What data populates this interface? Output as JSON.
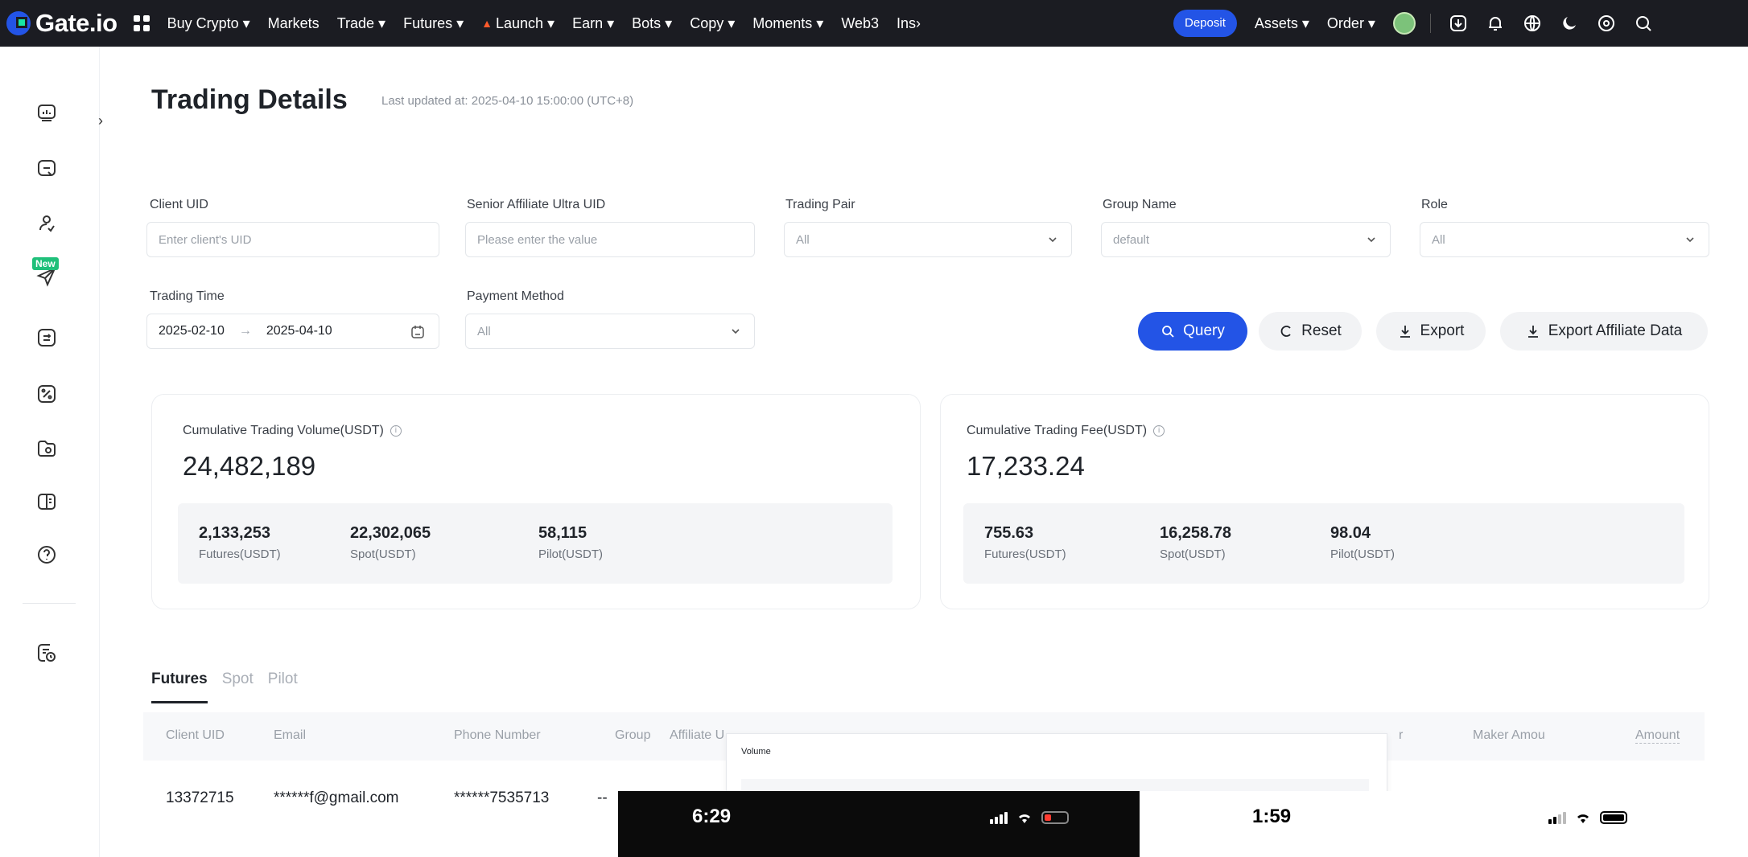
{
  "brand": {
    "name": "Gate.io"
  },
  "nav": {
    "items": [
      "Buy Crypto ▾",
      "Markets",
      "Trade ▾",
      "Futures ▾",
      "Launch ▾",
      "Earn ▾",
      "Bots ▾",
      "Copy ▾",
      "Moments ▾",
      "Web3",
      "Ins›"
    ],
    "deposit": "Deposit",
    "assets": "Assets ▾",
    "order": "Order ▾"
  },
  "sidebar": {
    "new_badge": "New",
    "toggle": "›"
  },
  "page": {
    "title": "Trading Details",
    "last_updated": "Last updated at: 2025-04-10 15:00:00 (UTC+8)"
  },
  "filters": {
    "client_uid": {
      "label": "Client UID",
      "placeholder": "Enter client's UID"
    },
    "senior_uid": {
      "label": "Senior Affiliate Ultra UID",
      "placeholder": "Please enter the value"
    },
    "trading_pair": {
      "label": "Trading Pair",
      "value": "All"
    },
    "group_name": {
      "label": "Group Name",
      "value": "default"
    },
    "role": {
      "label": "Role",
      "value": "All"
    },
    "trading_time": {
      "label": "Trading Time",
      "start": "2025-02-10",
      "arrow": "→",
      "end": "2025-04-10"
    },
    "payment_method": {
      "label": "Payment Method",
      "value": "All"
    }
  },
  "actions": {
    "query": "Query",
    "reset": "Reset",
    "export": "Export",
    "export_affiliate": "Export Affiliate Data"
  },
  "volume_card": {
    "label": "Cumulative Trading Volume(USDT)",
    "value": "24,482,189",
    "breakdown": [
      {
        "value": "2,133,253",
        "label": "Futures(USDT)"
      },
      {
        "value": "22,302,065",
        "label": "Spot(USDT)"
      },
      {
        "value": "58,115",
        "label": "Pilot(USDT)"
      }
    ]
  },
  "fee_card": {
    "label": "Cumulative Trading Fee(USDT)",
    "value": "17,233.24",
    "breakdown": [
      {
        "value": "755.63",
        "label": "Futures(USDT)"
      },
      {
        "value": "16,258.78",
        "label": "Spot(USDT)"
      },
      {
        "value": "98.04",
        "label": "Pilot(USDT)"
      }
    ]
  },
  "tabs": [
    "Futures",
    "Spot",
    "Pilot"
  ],
  "table": {
    "headers": [
      "Client UID",
      "Email",
      "Phone Number",
      "Group",
      "Affiliate U",
      "r",
      "Maker Amou",
      "Amount"
    ],
    "rows": [
      [
        "13372715",
        "******f@gmail.com",
        "******7535713",
        "--"
      ]
    ]
  },
  "overlay": {
    "title": "Volume"
  },
  "phone_status": {
    "time_left": "6:29",
    "time_right": "1:59"
  },
  "colors": {
    "accent": "#2354e6",
    "topbar": "#1b1c22",
    "new_badge": "#1fc07a",
    "battery_low": "#ff3b30"
  }
}
